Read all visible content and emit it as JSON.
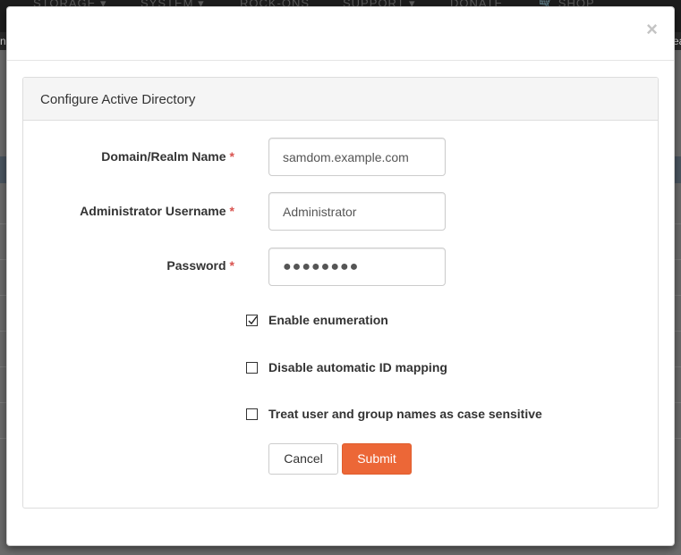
{
  "background": {
    "nav_items": [
      "STORAGE ▾",
      "SYSTEM ▾",
      "ROCK-ONS",
      "SUPPORT ▾",
      "DONATE",
      "🛒 SHOP"
    ],
    "edge_text_right": "ea",
    "edge_text_left": "n"
  },
  "modal": {
    "close_glyph": "×"
  },
  "panel": {
    "title": "Configure Active Directory"
  },
  "form": {
    "domain": {
      "label": "Domain/Realm Name",
      "required_mark": "*",
      "value": "samdom.example.com"
    },
    "username": {
      "label": "Administrator Username",
      "required_mark": "*",
      "value": "Administrator"
    },
    "password": {
      "label": "Password",
      "required_mark": "*",
      "value": "●●●●●●●●"
    },
    "checkboxes": [
      {
        "label": "Enable enumeration",
        "checked": true
      },
      {
        "label": "Disable automatic ID mapping",
        "checked": false
      },
      {
        "label": "Treat user and group names as case sensitive",
        "checked": false
      }
    ],
    "cancel_label": "Cancel",
    "submit_label": "Submit"
  },
  "colors": {
    "submit_bg": "#ec6737",
    "required": "#d9534f"
  }
}
